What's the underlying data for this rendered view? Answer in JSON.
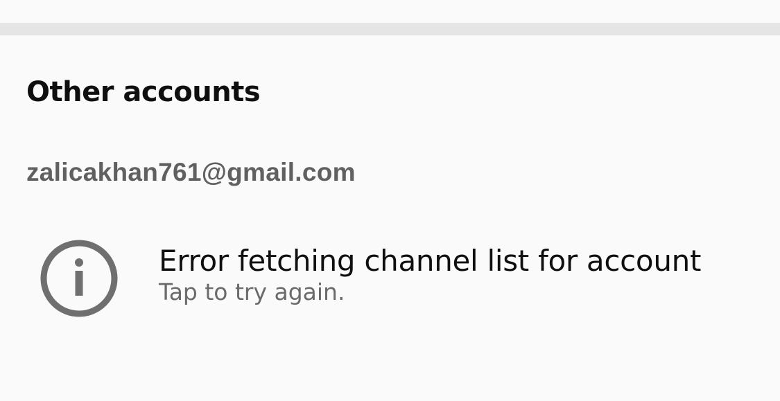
{
  "section": {
    "title": "Other accounts"
  },
  "account": {
    "email": "zalicakhan761@gmail.com"
  },
  "error_item": {
    "icon": "info-icon",
    "title": "Error fetching channel list for account",
    "subtitle": "Tap to try again."
  },
  "colors": {
    "background": "#fafafa",
    "divider": "#e5e5e5",
    "primary_text": "#0f0f0f",
    "secondary_text": "#606060",
    "icon": "#6f6f6f"
  }
}
